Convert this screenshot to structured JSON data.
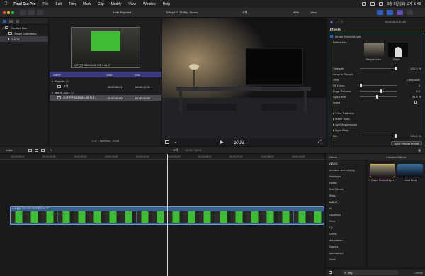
{
  "menubar": {
    "app": "Final Cut Pro",
    "items": [
      "File",
      "Edit",
      "Trim",
      "Mark",
      "Clip",
      "Modify",
      "View",
      "Window",
      "Help"
    ],
    "clock": "3월 9일 (토) 오후 5:48"
  },
  "toolbar": {
    "hide_rejected": "Hide Rejected",
    "format": "1080p HD 23.98p, Stereo",
    "viewer_title": "고백",
    "zoom": "69%",
    "view": "View",
    "inspector_time": "00:00:05:01  5:44:07"
  },
  "libraries": {
    "items": [
      {
        "label": "Creative Box",
        "level": 0,
        "selected": false
      },
      {
        "label": "Smart Collections",
        "level": 1,
        "selected": false
      },
      {
        "label": "3-8-24",
        "level": 1,
        "selected": true
      }
    ]
  },
  "browser": {
    "preview_caption": "스크린샷 2024-03-09 오후 5.44.07",
    "columns": {
      "name": "Name",
      "start": "Start",
      "end": "End"
    },
    "groups": [
      {
        "label": "Projects",
        "count": "(1)"
      },
      {
        "label": "Mar 9, 2024",
        "count": "(1)"
      }
    ],
    "rows": [
      {
        "name": "고백",
        "start": "00:00:00:00",
        "end": "00:00:10:01"
      },
      {
        "name": "스크린샷 2024-03-09 오후...",
        "start": "01:00:00:00",
        "end": "01:00:10:00"
      }
    ],
    "status": "1 of 2 selected, 10:00"
  },
  "viewer": {
    "timecode": "5:02",
    "tools_label": "▾"
  },
  "inspector": {
    "section": "Effects",
    "effect_name": "Green Screen Keyer",
    "refine_key": "Refine Key",
    "sample_color": "Sample Color",
    "edges": "Edges",
    "rows": [
      {
        "label": "Strength",
        "value": "100.0",
        "unit": "%",
        "slider": 1.0
      },
      {
        "label": "Jump to Sample",
        "value": "",
        "unit": "",
        "slider": null
      },
      {
        "label": "View",
        "value": "Composite",
        "unit": "",
        "slider": null
      },
      {
        "label": "Fill Holes",
        "value": "0",
        "unit": "",
        "slider": 0.0
      },
      {
        "label": "Edge Distance",
        "value": "5.0",
        "unit": "",
        "slider": 0.6
      },
      {
        "label": "Spill Level",
        "value": "46.5",
        "unit": "%",
        "slider": 0.465
      },
      {
        "label": "Invert",
        "value": "",
        "unit": "",
        "slider": null
      }
    ],
    "groups": [
      "Color Selection",
      "Matte Tools",
      "Spill Suppression",
      "Light Wrap"
    ],
    "mix_label": "Mix",
    "mix_value": "100.0",
    "mix_unit": "%",
    "save_preset": "Save Effects Preset"
  },
  "timeline": {
    "index_label": "Index",
    "project": "고백",
    "duration": "00:00 / 10:01",
    "ruler": [
      "00:00:00:00",
      "00:00:01:00",
      "00:00:02:00",
      "00:00:03:00",
      "00:00:04:00",
      "00:00:05:00",
      "00:00:06:00",
      "00:00:07:00",
      "00:00:08:00",
      "00:00:09:00"
    ],
    "clip_title": "스크린샷 2024-03-09 오후 5.44.07",
    "playhead_fraction": 0.5
  },
  "effects_browser": {
    "title": "Effects",
    "installed": "Installed Effects",
    "categories": [
      {
        "label": "VIDEO",
        "head": true,
        "selected": false
      },
      {
        "label": "Interlace and Keying",
        "head": false,
        "selected": false
      },
      {
        "label": "Nostalgia",
        "head": false,
        "selected": false
      },
      {
        "label": "Stylize",
        "head": false,
        "selected": false
      },
      {
        "label": "Text Effects",
        "head": false,
        "selected": false
      },
      {
        "label": "Tiling",
        "head": false,
        "selected": false
      },
      {
        "label": "AUDIO",
        "head": true,
        "selected": false
      },
      {
        "label": "All",
        "head": false,
        "selected": false
      },
      {
        "label": "Distortion",
        "head": false,
        "selected": false
      },
      {
        "label": "Echo",
        "head": false,
        "selected": false
      },
      {
        "label": "EQ",
        "head": false,
        "selected": false
      },
      {
        "label": "Levels",
        "head": false,
        "selected": false
      },
      {
        "label": "Modulation",
        "head": false,
        "selected": false
      },
      {
        "label": "Spaces",
        "head": false,
        "selected": false
      },
      {
        "label": "Specialized",
        "head": false,
        "selected": false
      },
      {
        "label": "Voice",
        "head": false,
        "selected": false
      }
    ],
    "effects": [
      {
        "name": "Green Screen Keyer"
      },
      {
        "name": "Luma Keyer"
      }
    ],
    "search_value": "key",
    "count": "2 items"
  },
  "colors": {
    "accent": "#2f5fc0",
    "green": "#3ebc36",
    "clip": "#385e8e"
  }
}
